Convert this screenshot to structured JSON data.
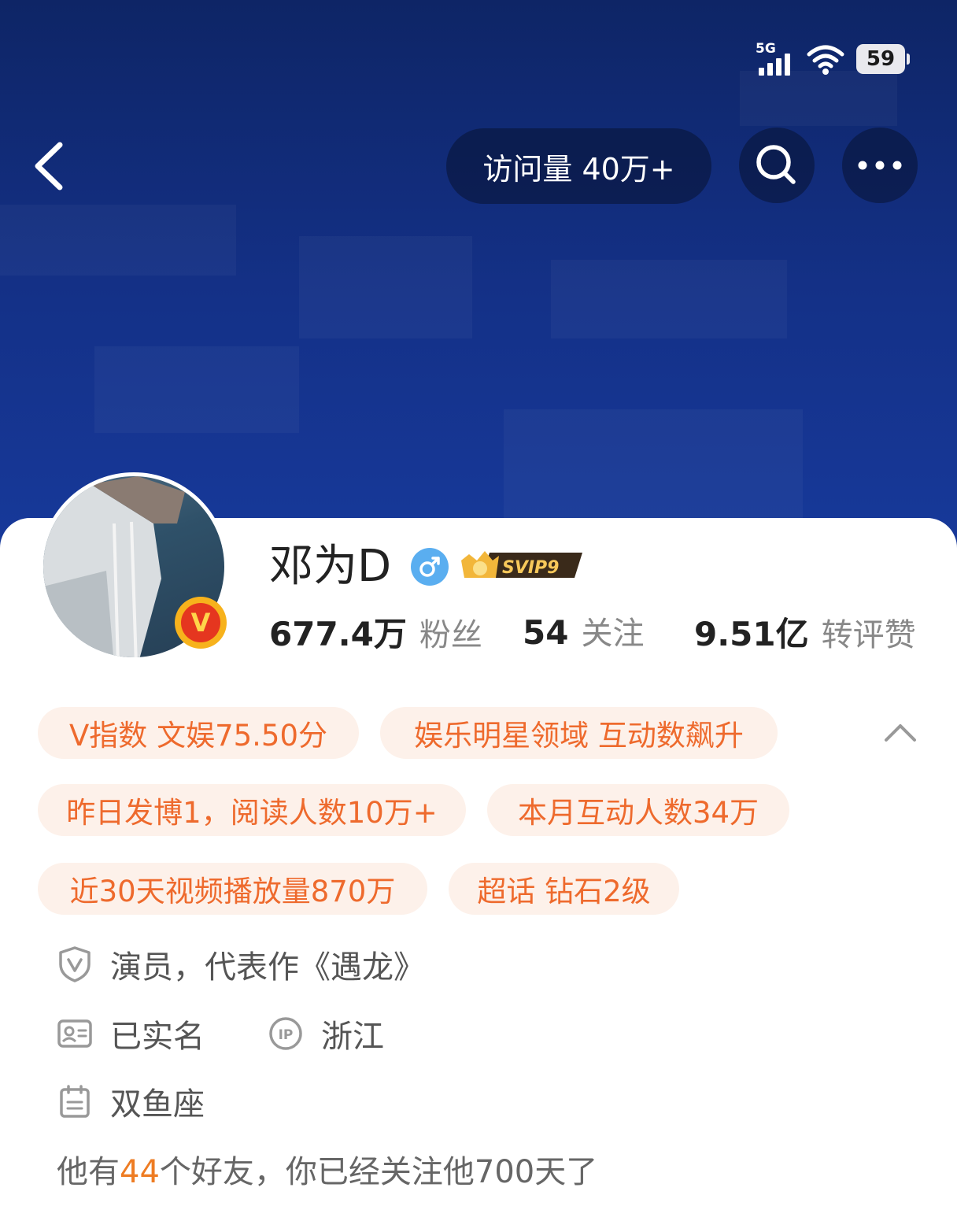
{
  "status_bar": {
    "network": "5G",
    "battery": "59"
  },
  "header": {
    "visits_label": "访问量 40万+"
  },
  "profile": {
    "name": "邓为D",
    "verified_badge": "V",
    "vip_label": "SVIP9",
    "stats": [
      {
        "value": "677.4万",
        "label": "粉丝"
      },
      {
        "value": "54",
        "label": "关注"
      },
      {
        "value": "9.51亿",
        "label": "转评赞"
      }
    ]
  },
  "tags": [
    "V指数 文娱75.50分",
    "娱乐明星领域 互动数飙升",
    "昨日发博1，阅读人数10万+",
    "本月互动人数34万",
    "近30天视频播放量870万",
    "超话 钻石2级"
  ],
  "info": {
    "verification": "演员，代表作《遇龙》",
    "real_name": "已实名",
    "ip_icon_text": "IP",
    "ip_location": "浙江",
    "zodiac": "双鱼座"
  },
  "friends": {
    "prefix": "他有",
    "count": "44",
    "suffix": "个好友，你已经关注他700天了"
  },
  "colors": {
    "accent": "#ee6a2d",
    "tag_bg": "#fdf1ea",
    "header_bg": "#143188",
    "gender": "#5aaef0"
  }
}
